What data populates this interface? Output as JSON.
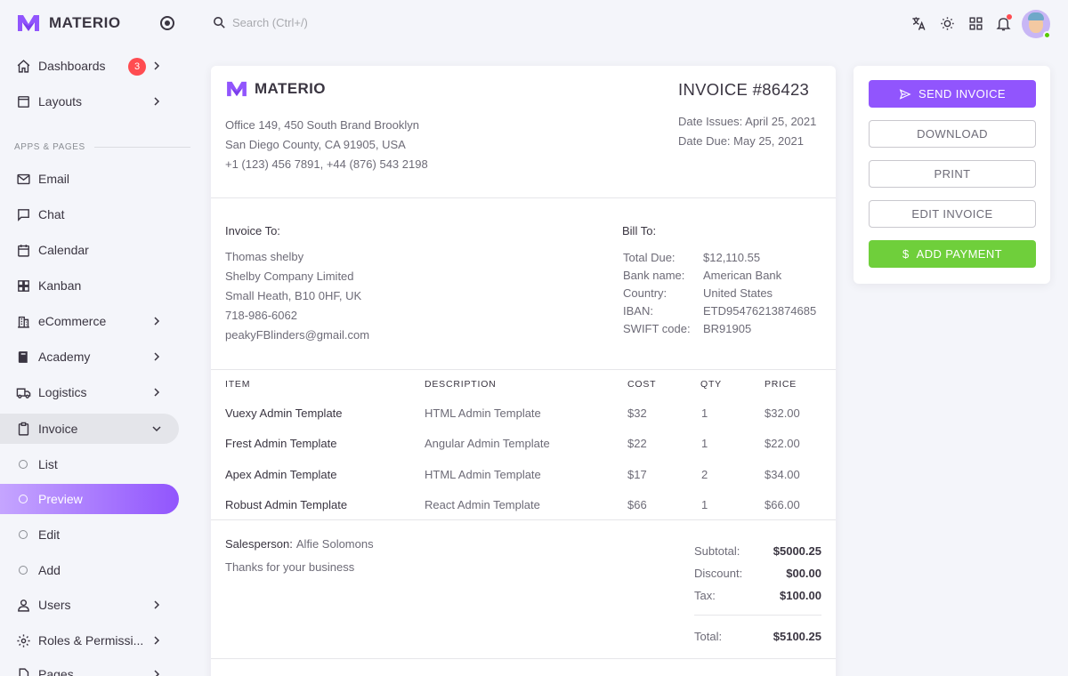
{
  "brand": {
    "name": "MATERIO"
  },
  "sidebar": {
    "section_label": "APPS & PAGES",
    "items": [
      {
        "label": "Dashboards",
        "badge": "3",
        "icon": "home-icon"
      },
      {
        "label": "Layouts",
        "icon": "window-icon"
      },
      {
        "label": "Email",
        "icon": "mail-icon"
      },
      {
        "label": "Chat",
        "icon": "chat-icon"
      },
      {
        "label": "Calendar",
        "icon": "calendar-icon"
      },
      {
        "label": "Kanban",
        "icon": "grid-icon"
      },
      {
        "label": "eCommerce",
        "icon": "building-icon"
      },
      {
        "label": "Academy",
        "icon": "book-icon"
      },
      {
        "label": "Logistics",
        "icon": "truck-icon"
      },
      {
        "label": "Invoice",
        "icon": "clipboard-icon"
      },
      {
        "label": "List"
      },
      {
        "label": "Preview"
      },
      {
        "label": "Edit"
      },
      {
        "label": "Add"
      },
      {
        "label": "Users",
        "icon": "user-icon"
      },
      {
        "label": "Roles & Permissi...",
        "icon": "gear-icon"
      },
      {
        "label": "Pages",
        "icon": "file-icon"
      }
    ]
  },
  "topbar": {
    "search_placeholder": "Search (Ctrl+/)"
  },
  "invoice": {
    "brand": "MATERIO",
    "address": [
      "Office 149, 450 South Brand Brooklyn",
      "San Diego County, CA 91905, USA",
      "+1 (123) 456 7891, +44 (876) 543 2198"
    ],
    "title": "INVOICE #86423",
    "date_issued": "Date Issues: April 25, 2021",
    "date_due": "Date Due: May 25, 2021",
    "invoice_to": {
      "heading": "Invoice To:",
      "lines": [
        "Thomas shelby",
        "Shelby Company Limited",
        "Small Heath, B10 0HF, UK",
        "718-986-6062",
        "peakyFBlinders@gmail.com"
      ]
    },
    "bill_to": {
      "heading": "Bill To:",
      "rows": [
        {
          "k": "Total Due:",
          "v": "$12,110.55"
        },
        {
          "k": "Bank name:",
          "v": "American Bank"
        },
        {
          "k": "Country:",
          "v": "United States"
        },
        {
          "k": "IBAN:",
          "v": "ETD95476213874685"
        },
        {
          "k": "SWIFT code:",
          "v": "BR91905"
        }
      ]
    },
    "table": {
      "headers": [
        "ITEM",
        "DESCRIPTION",
        "COST",
        "QTY",
        "PRICE"
      ],
      "rows": [
        [
          "Vuexy Admin Template",
          "HTML Admin Template",
          "$32",
          "1",
          "$32.00"
        ],
        [
          "Frest Admin Template",
          "Angular Admin Template",
          "$22",
          "1",
          "$22.00"
        ],
        [
          "Apex Admin Template",
          "HTML Admin Template",
          "$17",
          "2",
          "$34.00"
        ],
        [
          "Robust Admin Template",
          "React Admin Template",
          "$66",
          "1",
          "$66.00"
        ]
      ]
    },
    "salesperson_label": "Salesperson:",
    "salesperson": "Alfie Solomons",
    "thanks": "Thanks for your business",
    "totals": [
      {
        "k": "Subtotal:",
        "v": "$5000.25"
      },
      {
        "k": "Discount:",
        "v": "$00.00"
      },
      {
        "k": "Tax:",
        "v": "$100.00"
      },
      {
        "k": "Total:",
        "v": "$5100.25"
      }
    ]
  },
  "actions": {
    "send": "SEND INVOICE",
    "download": "DOWNLOAD",
    "print": "PRINT",
    "edit": "EDIT INVOICE",
    "add_payment": "ADD PAYMENT",
    "add_payment_icon_text": "$"
  },
  "colors": {
    "primary": "#9155fd",
    "success": "#6fcf3b",
    "danger": "#ff4c51"
  }
}
